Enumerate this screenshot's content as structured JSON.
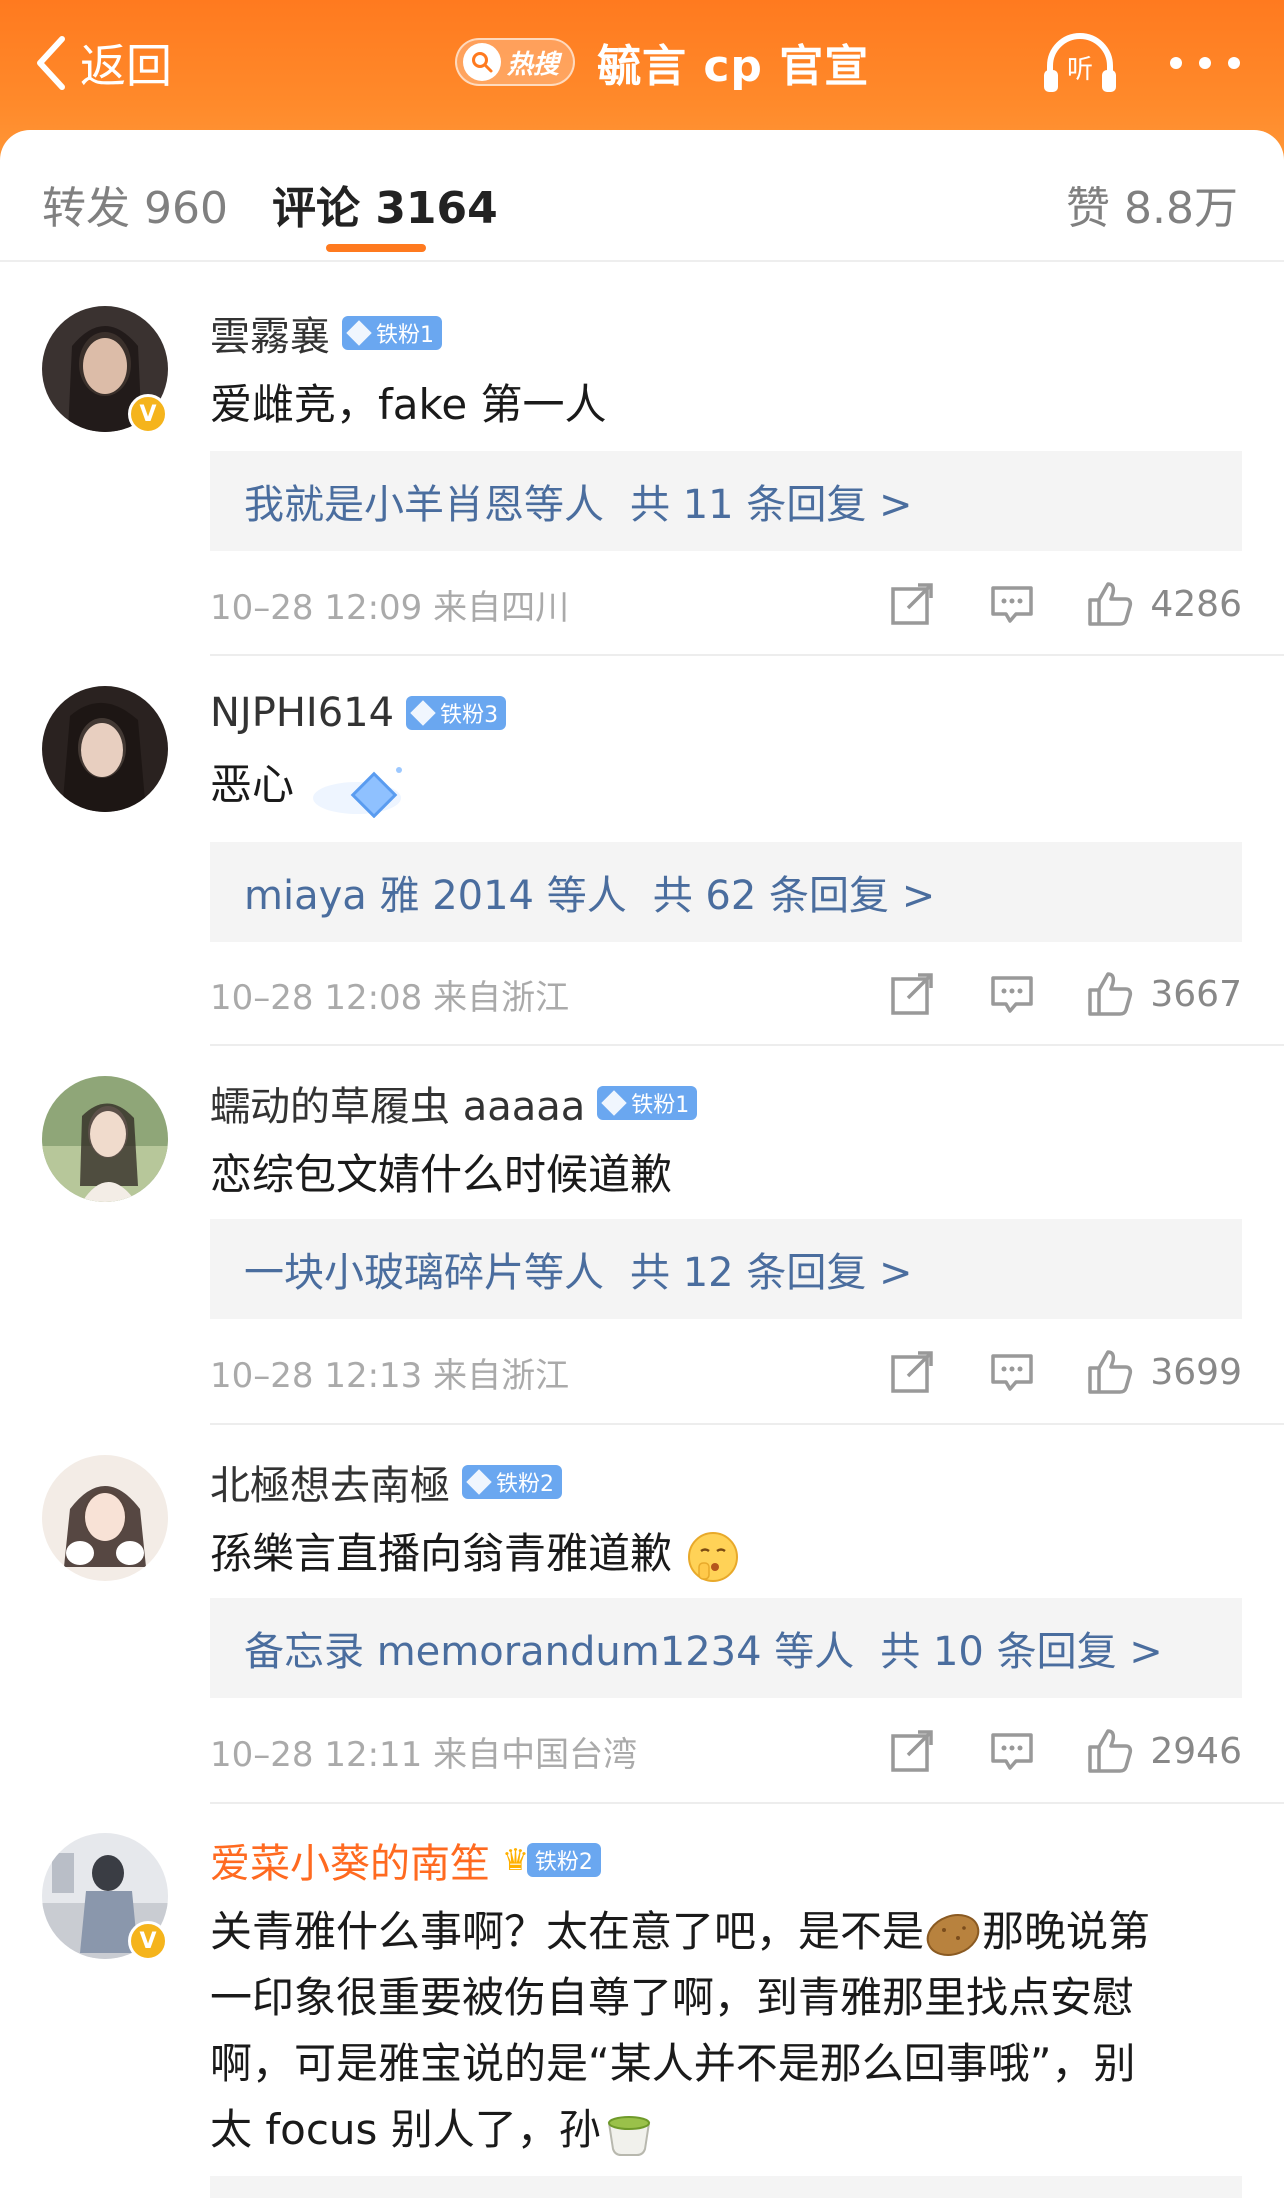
{
  "header": {
    "back_label": "返回",
    "hot_label": "热搜",
    "title": "毓言 cp 官宣"
  },
  "tabs": {
    "repost": "转发 960",
    "comments": "评论 3164",
    "likes": "赞 8.8万"
  },
  "colors": {
    "brand_orange": "#ff7a1f",
    "link_blue": "#4a6d9e",
    "fan_badge_blue": "#6aa7f0"
  },
  "comments": [
    {
      "username": "雲霧襄",
      "badge": "铁粉1",
      "text": "爱雌竞，fake 第一人",
      "reply_users": "我就是小羊肖恩等人",
      "reply_count": "共 11 条回复 >",
      "time": "10–28 12:09  来自四川",
      "likes": "4286"
    },
    {
      "username": "NJPHI614",
      "badge": "铁粉3",
      "text": "恶心",
      "reply_users": "miaya 雅 2014 等人",
      "reply_count": "共 62 条回复 >",
      "time": "10–28 12:08  来自浙江",
      "likes": "3667"
    },
    {
      "username": "蠕动的草履虫 aaaaa",
      "badge": "铁粉1",
      "text": "恋综包文婧什么时候道歉",
      "reply_users": "一块小玻璃碎片等人",
      "reply_count": "共 12 条回复 >",
      "time": "10–28 12:13  来自浙江",
      "likes": "3699"
    },
    {
      "username": "北極想去南極",
      "badge": "铁粉2",
      "text": "孫樂言直播向翁青雅道歉",
      "reply_users": "备忘录 memorandum1234 等人",
      "reply_count": "共 10 条回复 >",
      "time": "10–28 12:11  来自中国台湾",
      "likes": "2946"
    },
    {
      "username": "爱菜小葵的南笙",
      "badge": "铁粉2",
      "text_lines": [
        "关青雅什么事啊？太在意了吧，是不是",
        "那晚说第",
        "一印象很重要被伤自尊了啊，到青雅那里找点安慰",
        "啊，可是雅宝说的是“某人并不是那么回事哦”，别",
        "太 focus 别人了，孙"
      ]
    }
  ],
  "icons": [
    "back-chevron-icon",
    "search-icon",
    "headphones-icon",
    "more-dots-icon",
    "repost-icon",
    "comment-icon",
    "thumbs-up-icon",
    "verified-icon",
    "diamond-icon",
    "crown-icon",
    "potato-emoji",
    "tea-emoji",
    "shush-emoji"
  ]
}
